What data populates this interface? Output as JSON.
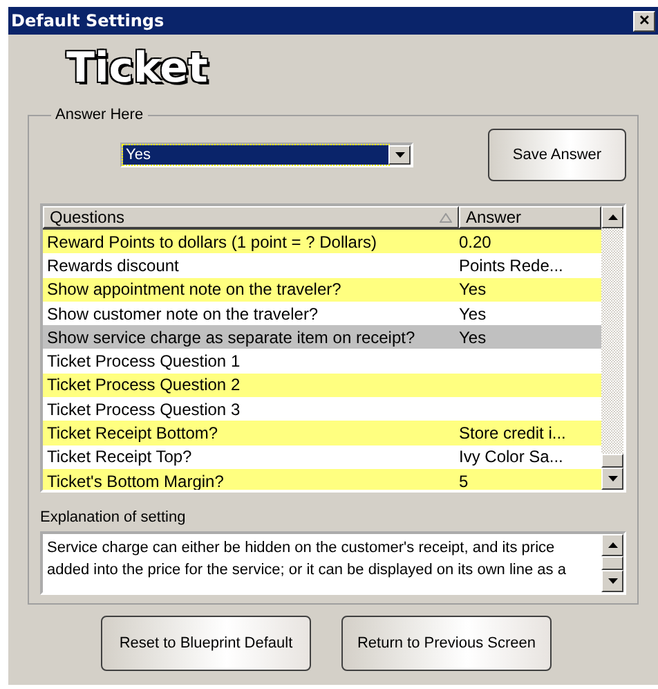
{
  "window": {
    "title": "Default Settings",
    "close": "✕"
  },
  "heading": "Ticket",
  "answer_group": {
    "label": "Answer Here",
    "dropdown": {
      "value": "Yes"
    },
    "save_button": "Save Answer"
  },
  "table": {
    "columns": [
      "Questions",
      "Answer"
    ],
    "rows": [
      {
        "question": "Reward Points to dollars (1 point = ? Dollars)",
        "answer": "0.20",
        "selected": false
      },
      {
        "question": "Rewards discount",
        "answer": "Points Rede...",
        "selected": false
      },
      {
        "question": "Show appointment note on the traveler?",
        "answer": "Yes",
        "selected": false
      },
      {
        "question": "Show customer note on the traveler?",
        "answer": "Yes",
        "selected": false
      },
      {
        "question": "Show service charge as separate item on receipt?",
        "answer": "Yes",
        "selected": true
      },
      {
        "question": "Ticket Process Question 1",
        "answer": "",
        "selected": false
      },
      {
        "question": "Ticket Process Question 2",
        "answer": "",
        "selected": false
      },
      {
        "question": "Ticket Process Question 3",
        "answer": "",
        "selected": false
      },
      {
        "question": "Ticket Receipt Bottom?",
        "answer": "Store credit i...",
        "selected": false
      },
      {
        "question": "Ticket Receipt Top?",
        "answer": "Ivy Color Sa...",
        "selected": false
      },
      {
        "question": "Ticket's Bottom Margin?",
        "answer": "5",
        "selected": false
      }
    ]
  },
  "explanation": {
    "label": "Explanation of setting",
    "text": "Service charge can either be hidden on the customer's receipt, and its price added into the price for the service; or it can be displayed on its own line as a"
  },
  "buttons": [
    "Reset to Blueprint Default",
    "Return to Previous Screen"
  ]
}
